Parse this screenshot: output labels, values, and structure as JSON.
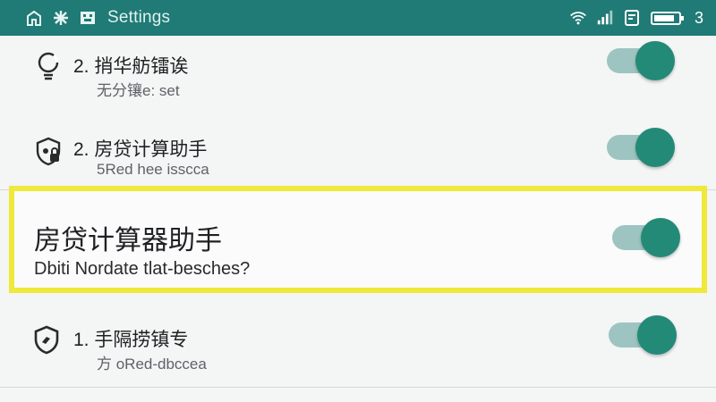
{
  "status_bar": {
    "title": "Settings",
    "battery_suffix": "3",
    "left_icons": [
      "home-icon",
      "bug-icon",
      "media-icon"
    ],
    "right_icons": [
      "wifi-icon",
      "signal-icon",
      "notification-icon",
      "battery-icon"
    ],
    "color": "#207a76"
  },
  "settings": {
    "items": [
      {
        "title": "2. 捎华舫镭诶",
        "subtitle": "无分镶e: set",
        "icon": "lightbulb-icon",
        "enabled": true
      },
      {
        "title": "2. 房贷计算助手",
        "subtitle": "5Red hee isscca",
        "icon": "shield-lock-icon",
        "enabled": true
      },
      {
        "title": "房贷计算器助手",
        "subtitle": "Dbiti Nordate tlat-besches?",
        "icon": "",
        "enabled": true,
        "highlighted": true
      },
      {
        "title": "1. 手隔捞镇专",
        "subtitle": "方 oRed-dbccea",
        "icon": "shield-check-icon",
        "enabled": true
      }
    ]
  },
  "colors": {
    "accent": "#238a78",
    "track": "#9ec4c1",
    "highlight": "#eee93a"
  }
}
